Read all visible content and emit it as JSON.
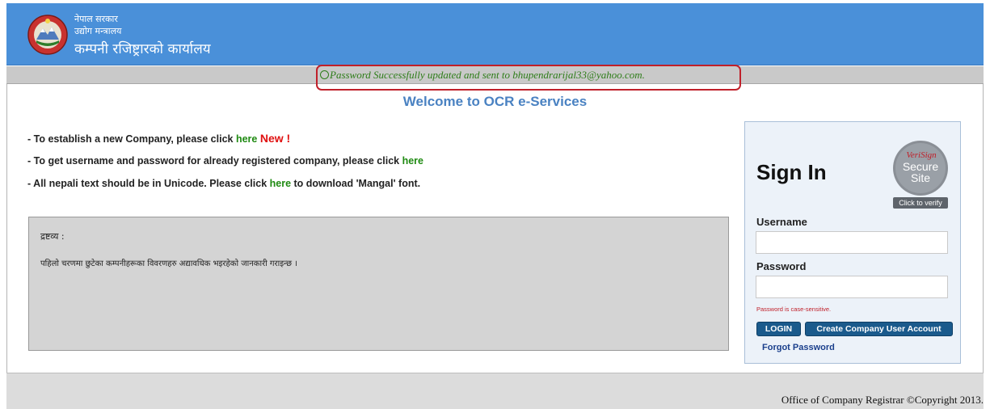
{
  "header": {
    "line1": "नेपाल सरकार",
    "line2": "उद्योग मन्त्रालय",
    "line3": "कम्पनी रजिष्ट्रारको कार्यालय"
  },
  "message": {
    "text": "Password Successfully updated and sent to bhupendrarijal33@yahoo.com."
  },
  "main": {
    "welcome": "Welcome to OCR e-Services",
    "line1": {
      "text": "- To establish a new Company, please click ",
      "link": "here",
      "new": "New !"
    },
    "line2": {
      "text": "- To get username and password for already registered company, please click ",
      "link": "here"
    },
    "line3": {
      "before": "- All nepali text should be in Unicode. Please click ",
      "link": "here",
      "after": " to download 'Mangal' font."
    },
    "notice": {
      "title": "द्रष्टव्य :",
      "body": "पहिलो चरणमा छुटेका कम्पनीहरूका विवरणहरु अद्यावधिक भइरहेको जानकारी गराइन्छ ।"
    }
  },
  "signin": {
    "title": "Sign In",
    "badge": {
      "line1": "VeriSign",
      "line2": "Secure",
      "line3": "Site",
      "caption": "Click to verify"
    },
    "username_label": "Username",
    "password_label": "Password",
    "username_value": "",
    "password_value": "",
    "case_note": "Password is case-sensitive.",
    "login_label": "LOGIN",
    "create_label": "Create Company User Account",
    "forgot_label": "Forgot Password"
  },
  "footer": {
    "text": "Office of Company Registrar ©Copyright 2013."
  },
  "colors": {
    "header_blue": "#4a90d9",
    "success_green": "#2e7d19",
    "highlight_red": "#c0202a",
    "link_green": "#1f8a12",
    "button_blue": "#1a5a8c"
  }
}
